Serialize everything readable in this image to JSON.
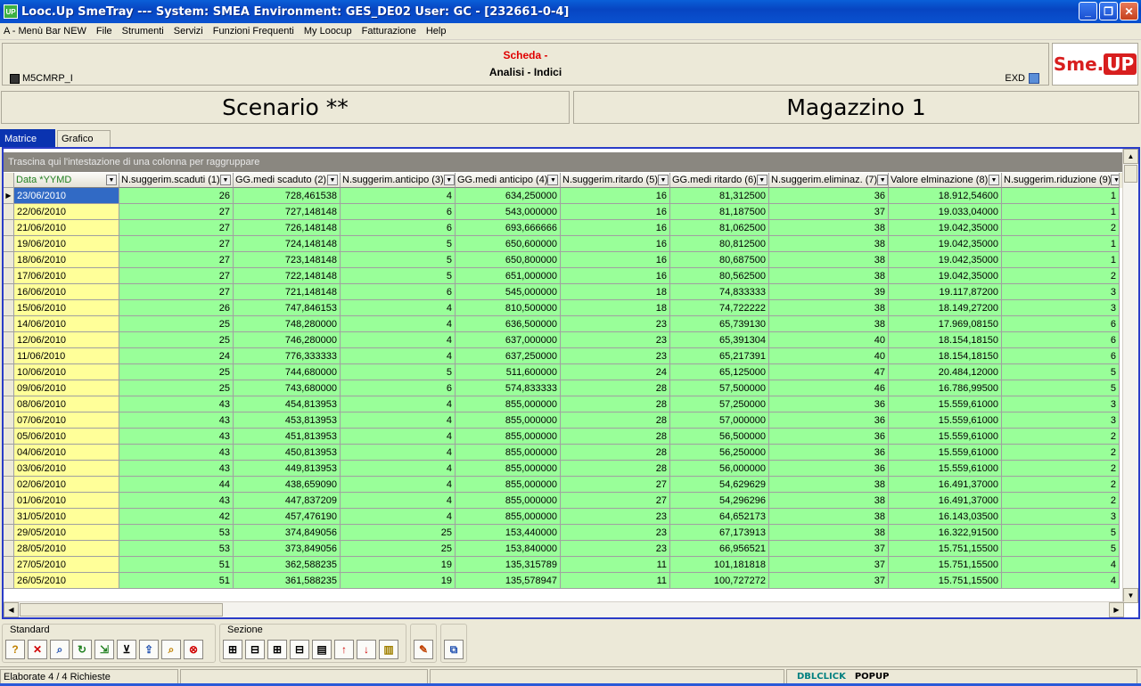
{
  "window": {
    "title": "Looc.Up SmeTray --- System: SMEA Environment: GES_DE02 User: GC - [232661-0-4]",
    "icon_text": "UP"
  },
  "menu": [
    "A - Menù Bar NEW",
    "File",
    "Strumenti",
    "Servizi",
    "Funzioni Frequenti",
    "My Loocup",
    "Fatturazione",
    "Help"
  ],
  "header": {
    "scheda": "Scheda -",
    "subtitle": "Analisi - Indici",
    "code": "M5CMRP_I",
    "exd": "EXD",
    "logo_left": "Sme.",
    "logo_right": "UP"
  },
  "panels": {
    "left": "Scenario **",
    "right": "Magazzino 1"
  },
  "tabs": [
    "Matrice",
    "Grafico"
  ],
  "grid": {
    "group_hint": "Trascina qui l'intestazione di una colonna per raggruppare",
    "columns": [
      "Data *YYMD",
      "N.suggerim.scaduti (1)",
      "GG.medi scaduto (2)",
      "N.suggerim.anticipo (3)",
      "GG.medi anticipo (4)",
      "N.suggerim.ritardo (5)",
      "GG.medi ritardo (6)",
      "N.suggerim.eliminaz. (7)",
      "Valore elminazione (8)",
      "N.suggerim.riduzione (9)"
    ],
    "rows": [
      [
        "23/06/2010",
        "26",
        "728,461538",
        "4",
        "634,250000",
        "16",
        "81,312500",
        "36",
        "18.912,54600",
        "1"
      ],
      [
        "22/06/2010",
        "27",
        "727,148148",
        "6",
        "543,000000",
        "16",
        "81,187500",
        "37",
        "19.033,04000",
        "1"
      ],
      [
        "21/06/2010",
        "27",
        "726,148148",
        "6",
        "693,666666",
        "16",
        "81,062500",
        "38",
        "19.042,35000",
        "2"
      ],
      [
        "19/06/2010",
        "27",
        "724,148148",
        "5",
        "650,600000",
        "16",
        "80,812500",
        "38",
        "19.042,35000",
        "1"
      ],
      [
        "18/06/2010",
        "27",
        "723,148148",
        "5",
        "650,800000",
        "16",
        "80,687500",
        "38",
        "19.042,35000",
        "1"
      ],
      [
        "17/06/2010",
        "27",
        "722,148148",
        "5",
        "651,000000",
        "16",
        "80,562500",
        "38",
        "19.042,35000",
        "2"
      ],
      [
        "16/06/2010",
        "27",
        "721,148148",
        "6",
        "545,000000",
        "18",
        "74,833333",
        "39",
        "19.117,87200",
        "3"
      ],
      [
        "15/06/2010",
        "26",
        "747,846153",
        "4",
        "810,500000",
        "18",
        "74,722222",
        "38",
        "18.149,27200",
        "3"
      ],
      [
        "14/06/2010",
        "25",
        "748,280000",
        "4",
        "636,500000",
        "23",
        "65,739130",
        "38",
        "17.969,08150",
        "6"
      ],
      [
        "12/06/2010",
        "25",
        "746,280000",
        "4",
        "637,000000",
        "23",
        "65,391304",
        "40",
        "18.154,18150",
        "6"
      ],
      [
        "11/06/2010",
        "24",
        "776,333333",
        "4",
        "637,250000",
        "23",
        "65,217391",
        "40",
        "18.154,18150",
        "6"
      ],
      [
        "10/06/2010",
        "25",
        "744,680000",
        "5",
        "511,600000",
        "24",
        "65,125000",
        "47",
        "20.484,12000",
        "5"
      ],
      [
        "09/06/2010",
        "25",
        "743,680000",
        "6",
        "574,833333",
        "28",
        "57,500000",
        "46",
        "16.786,99500",
        "5"
      ],
      [
        "08/06/2010",
        "43",
        "454,813953",
        "4",
        "855,000000",
        "28",
        "57,250000",
        "36",
        "15.559,61000",
        "3"
      ],
      [
        "07/06/2010",
        "43",
        "453,813953",
        "4",
        "855,000000",
        "28",
        "57,000000",
        "36",
        "15.559,61000",
        "3"
      ],
      [
        "05/06/2010",
        "43",
        "451,813953",
        "4",
        "855,000000",
        "28",
        "56,500000",
        "36",
        "15.559,61000",
        "2"
      ],
      [
        "04/06/2010",
        "43",
        "450,813953",
        "4",
        "855,000000",
        "28",
        "56,250000",
        "36",
        "15.559,61000",
        "2"
      ],
      [
        "03/06/2010",
        "43",
        "449,813953",
        "4",
        "855,000000",
        "28",
        "56,000000",
        "36",
        "15.559,61000",
        "2"
      ],
      [
        "02/06/2010",
        "44",
        "438,659090",
        "4",
        "855,000000",
        "27",
        "54,629629",
        "38",
        "16.491,37000",
        "2"
      ],
      [
        "01/06/2010",
        "43",
        "447,837209",
        "4",
        "855,000000",
        "27",
        "54,296296",
        "38",
        "16.491,37000",
        "2"
      ],
      [
        "31/05/2010",
        "42",
        "457,476190",
        "4",
        "855,000000",
        "23",
        "64,652173",
        "38",
        "16.143,03500",
        "3"
      ],
      [
        "29/05/2010",
        "53",
        "374,849056",
        "25",
        "153,440000",
        "23",
        "67,173913",
        "38",
        "16.322,91500",
        "5"
      ],
      [
        "28/05/2010",
        "53",
        "373,849056",
        "25",
        "153,840000",
        "23",
        "66,956521",
        "37",
        "15.751,15500",
        "5"
      ],
      [
        "27/05/2010",
        "51",
        "362,588235",
        "19",
        "135,315789",
        "11",
        "101,181818",
        "37",
        "15.751,15500",
        "4"
      ],
      [
        "26/05/2010",
        "51",
        "361,588235",
        "19",
        "135,578947",
        "11",
        "100,727272",
        "37",
        "15.751,15500",
        "4"
      ]
    ]
  },
  "toolbar": {
    "standard_label": "Standard",
    "sezione_label": "Sezione"
  },
  "status": {
    "left": "Elaborate 4 / 4 Richieste",
    "dblclick": "DBLCLICK",
    "popup": "POPUP"
  }
}
